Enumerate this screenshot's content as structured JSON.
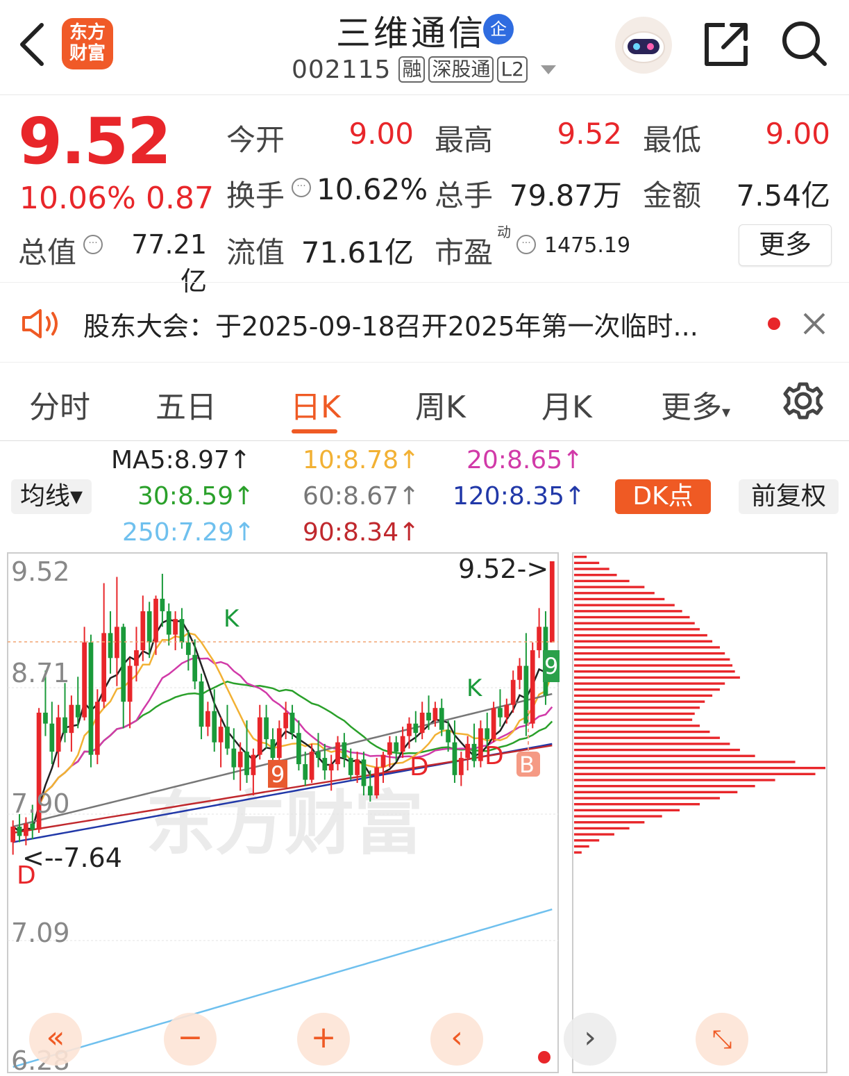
{
  "header": {
    "logo_line1": "东方",
    "logo_line2": "财富",
    "stock_name": "三维通信",
    "ent_badge": "企",
    "stock_code": "002115",
    "tags": [
      "融",
      "深股通",
      "L2"
    ]
  },
  "quote": {
    "price": "9.52",
    "change_pct": "10.06%",
    "change": "0.87",
    "open_label": "今开",
    "open": "9.00",
    "high_label": "最高",
    "high": "9.52",
    "low_label": "最低",
    "low": "9.00",
    "turnover_label": "换手",
    "turnover": "10.62%",
    "volume_label": "总手",
    "volume": "79.87万",
    "amount_label": "金额",
    "amount": "7.54亿",
    "mktcap_label": "总值",
    "mktcap": "77.21亿",
    "float_label": "流值",
    "float": "71.61亿",
    "pe_label": "市盈",
    "pe_sup": "动",
    "pe": "1475.19",
    "more_label": "更多"
  },
  "notice": {
    "text": "股东大会：于2025-09-18召开2025年第一次临时..."
  },
  "tabs": [
    "分时",
    "五日",
    "日K",
    "周K",
    "月K",
    "更多"
  ],
  "active_tab": "日K",
  "ma_legend": {
    "ma5": "MA5:8.97↑",
    "ma10": "10:8.78↑",
    "ma20": "20:8.65↑",
    "ma30": "30:8.59↑",
    "ma60": "60:8.67↑",
    "ma120": "120:8.35↑",
    "ma250": "250:7.29↑",
    "ma90": "90:8.34↑",
    "avg_button": "均线▾",
    "dk_button": "DK点",
    "fq_button": "前复权"
  },
  "colors": {
    "up": "#e8262a",
    "down": "#1a9a3a",
    "accent": "#ef5a24",
    "ma5": "#222222",
    "ma10": "#f2b134",
    "ma20": "#d13aa8",
    "ma30": "#2aa02a",
    "ma60": "#777777",
    "ma120": "#2138a8",
    "ma250": "#6fc0ee",
    "ma90": "#c0282d"
  },
  "chart_data": {
    "type": "candlestick",
    "y_ticks": [
      "9.52",
      "8.71",
      "7.90",
      "7.09",
      "6.28"
    ],
    "ylim": [
      6.28,
      9.52
    ],
    "high_marker": "9.52->",
    "low_marker": "<--7.64",
    "watermark": "东方财富",
    "signal_labels": [
      "K",
      "K",
      "D",
      "D",
      "D",
      "B",
      "9",
      "9"
    ],
    "candles": [
      [
        7.72,
        7.86,
        7.64,
        7.82
      ],
      [
        7.82,
        7.9,
        7.72,
        7.76
      ],
      [
        7.76,
        7.88,
        7.7,
        7.84
      ],
      [
        7.84,
        7.96,
        7.74,
        7.8
      ],
      [
        7.8,
        8.58,
        7.78,
        8.55
      ],
      [
        8.55,
        8.82,
        8.4,
        8.48
      ],
      [
        8.48,
        8.62,
        8.22,
        8.3
      ],
      [
        8.3,
        8.6,
        8.2,
        8.52
      ],
      [
        8.52,
        8.74,
        8.36,
        8.42
      ],
      [
        8.42,
        8.66,
        8.3,
        8.6
      ],
      [
        8.6,
        8.78,
        8.45,
        8.52
      ],
      [
        8.52,
        9.1,
        8.5,
        9.0
      ],
      [
        9.0,
        9.05,
        8.2,
        8.28
      ],
      [
        8.28,
        8.7,
        8.22,
        8.62
      ],
      [
        8.62,
        9.38,
        8.58,
        9.06
      ],
      [
        9.06,
        9.2,
        8.8,
        8.9
      ],
      [
        8.9,
        9.42,
        8.72,
        9.1
      ],
      [
        9.1,
        9.12,
        8.45,
        8.62
      ],
      [
        8.62,
        8.9,
        8.45,
        8.85
      ],
      [
        8.85,
        9.1,
        8.75,
        8.95
      ],
      [
        8.95,
        9.3,
        8.88,
        9.2
      ],
      [
        9.2,
        9.26,
        8.9,
        9.0
      ],
      [
        9.0,
        9.3,
        8.92,
        9.28
      ],
      [
        9.28,
        9.44,
        9.1,
        9.2
      ],
      [
        9.2,
        9.25,
        8.98,
        9.05
      ],
      [
        9.05,
        9.2,
        8.95,
        9.15
      ],
      [
        9.15,
        9.22,
        8.96,
        9.0
      ],
      [
        9.0,
        9.08,
        8.82,
        8.92
      ],
      [
        8.92,
        9.02,
        8.7,
        8.75
      ],
      [
        8.75,
        8.8,
        8.38,
        8.46
      ],
      [
        8.46,
        8.62,
        8.4,
        8.56
      ],
      [
        8.56,
        8.7,
        8.3,
        8.36
      ],
      [
        8.36,
        8.52,
        8.2,
        8.46
      ],
      [
        8.46,
        8.6,
        8.28,
        8.32
      ],
      [
        8.32,
        8.45,
        8.12,
        8.2
      ],
      [
        8.2,
        8.36,
        8.05,
        8.3
      ],
      [
        8.3,
        8.5,
        8.1,
        8.15
      ],
      [
        8.15,
        8.32,
        8.02,
        8.28
      ],
      [
        8.28,
        8.6,
        8.25,
        8.52
      ],
      [
        8.52,
        8.6,
        8.32,
        8.38
      ],
      [
        8.38,
        8.45,
        8.2,
        8.26
      ],
      [
        8.26,
        8.5,
        8.22,
        8.45
      ],
      [
        8.45,
        8.62,
        8.38,
        8.55
      ],
      [
        8.55,
        8.6,
        8.38,
        8.42
      ],
      [
        8.42,
        8.5,
        8.18,
        8.22
      ],
      [
        8.22,
        8.3,
        8.08,
        8.12
      ],
      [
        8.12,
        8.35,
        8.1,
        8.3
      ],
      [
        8.3,
        8.42,
        8.2,
        8.26
      ],
      [
        8.26,
        8.35,
        8.12,
        8.18
      ],
      [
        8.18,
        8.28,
        8.05,
        8.22
      ],
      [
        8.22,
        8.4,
        8.18,
        8.36
      ],
      [
        8.36,
        8.42,
        8.2,
        8.26
      ],
      [
        8.26,
        8.32,
        8.12,
        8.15
      ],
      [
        8.15,
        8.3,
        8.1,
        8.25
      ],
      [
        8.25,
        8.3,
        8.02,
        8.08
      ],
      [
        8.08,
        8.18,
        7.98,
        8.02
      ],
      [
        8.02,
        8.26,
        8.0,
        8.2
      ],
      [
        8.2,
        8.3,
        8.1,
        8.28
      ],
      [
        8.28,
        8.4,
        8.2,
        8.36
      ],
      [
        8.36,
        8.4,
        8.24,
        8.3
      ],
      [
        8.3,
        8.46,
        8.26,
        8.4
      ],
      [
        8.4,
        8.52,
        8.32,
        8.48
      ],
      [
        8.48,
        8.56,
        8.36,
        8.42
      ],
      [
        8.42,
        8.62,
        8.38,
        8.55
      ],
      [
        8.55,
        8.66,
        8.44,
        8.5
      ],
      [
        8.5,
        8.62,
        8.46,
        8.58
      ],
      [
        8.58,
        8.64,
        8.4,
        8.44
      ],
      [
        8.44,
        8.5,
        8.3,
        8.36
      ],
      [
        8.36,
        8.5,
        8.1,
        8.15
      ],
      [
        8.15,
        8.3,
        8.08,
        8.26
      ],
      [
        8.26,
        8.4,
        8.18,
        8.35
      ],
      [
        8.35,
        8.48,
        8.2,
        8.24
      ],
      [
        8.24,
        8.5,
        8.2,
        8.45
      ],
      [
        8.45,
        8.55,
        8.32,
        8.38
      ],
      [
        8.38,
        8.62,
        8.36,
        8.58
      ],
      [
        8.58,
        8.7,
        8.46,
        8.52
      ],
      [
        8.52,
        8.64,
        8.48,
        8.6
      ],
      [
        8.6,
        8.82,
        8.55,
        8.76
      ],
      [
        8.76,
        8.9,
        8.7,
        8.85
      ],
      [
        8.85,
        9.06,
        8.4,
        8.48
      ],
      [
        8.48,
        9.0,
        8.45,
        8.95
      ],
      [
        8.95,
        9.22,
        8.9,
        9.1
      ],
      [
        9.1,
        9.2,
        8.6,
        8.66
      ],
      [
        9.0,
        9.52,
        9.0,
        9.52
      ]
    ]
  },
  "profile_chart": {
    "bars": [
      0.05,
      0.1,
      0.14,
      0.17,
      0.22,
      0.28,
      0.32,
      0.36,
      0.4,
      0.43,
      0.46,
      0.48,
      0.5,
      0.53,
      0.55,
      0.58,
      0.6,
      0.62,
      0.63,
      0.64,
      0.66,
      0.6,
      0.58,
      0.55,
      0.52,
      0.5,
      0.48,
      0.47,
      0.5,
      0.54,
      0.58,
      0.62,
      0.66,
      0.72,
      0.88,
      1.0,
      0.96,
      0.8,
      0.72,
      0.65,
      0.58,
      0.5,
      0.42,
      0.35,
      0.28,
      0.22,
      0.16,
      0.1,
      0.06,
      0.03
    ]
  }
}
